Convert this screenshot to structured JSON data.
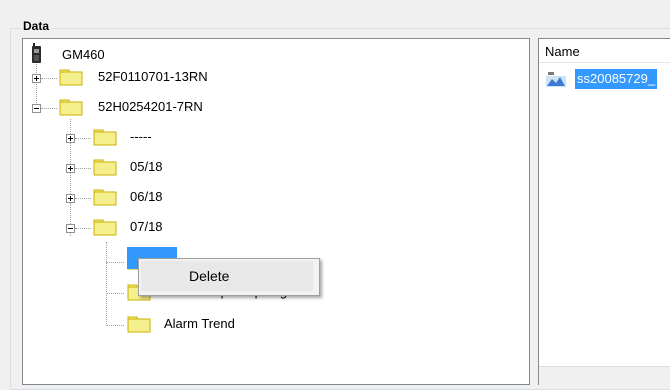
{
  "group": {
    "title": "Data"
  },
  "tree": {
    "device": "GM460",
    "items": [
      {
        "label": "52F0110701-13RN",
        "expanded": false
      },
      {
        "label": "52H0254201-7RN",
        "expanded": true,
        "children": [
          {
            "label": "-----",
            "expanded": false
          },
          {
            "label": "05/18",
            "expanded": false
          },
          {
            "label": "06/18",
            "expanded": false
          },
          {
            "label": "07/18",
            "expanded": true,
            "children": [
              {
                "label": ""
              },
              {
                "label": "Normal Op Snap Log"
              },
              {
                "label": "Alarm Trend"
              }
            ]
          }
        ]
      }
    ]
  },
  "context_menu": {
    "items": [
      "Delete"
    ]
  },
  "list": {
    "header": "Name",
    "items": [
      {
        "label": "ss20085729_"
      }
    ]
  },
  "colors": {
    "selection": "#3399ff",
    "folder": "#f5ee8c",
    "folder_edge": "#c9b200"
  }
}
